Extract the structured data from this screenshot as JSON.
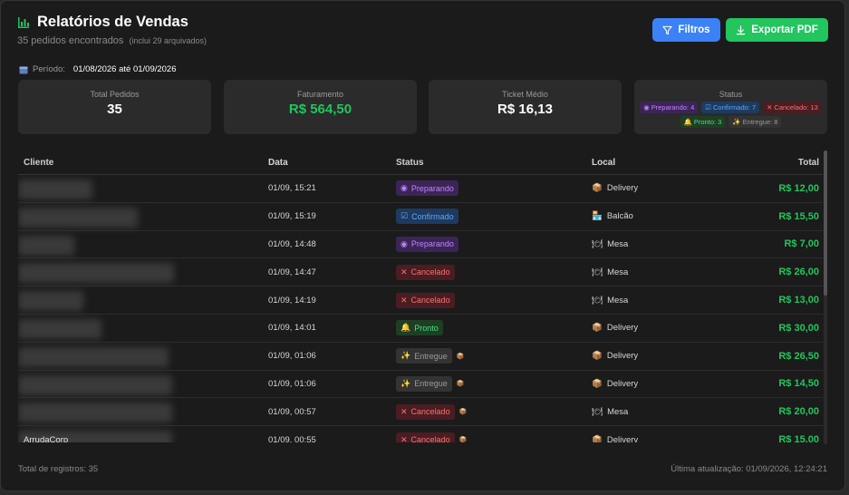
{
  "header": {
    "title": "Relatórios de Vendas",
    "subtitle": "35 pedidos encontrados",
    "subtitle_note": "(inclui 29 arquivados)"
  },
  "actions": {
    "filter_label": "Filtros",
    "export_label": "Exportar PDF"
  },
  "period": {
    "label": "Período:",
    "value": "01/08/2026 até 01/09/2026"
  },
  "cards": {
    "total_pedidos": {
      "label": "Total Pedidos",
      "value": "35"
    },
    "faturamento": {
      "label": "Faturamento",
      "value": "R$ 564,50"
    },
    "ticket": {
      "label": "Ticket Médio",
      "value": "R$ 16,13"
    },
    "status": {
      "label": "Status",
      "chips": [
        "Preparando: 4",
        "Confirmado: 7",
        "Cancelado: 13",
        "Pronto: 3",
        "Entregue: 8"
      ]
    }
  },
  "table": {
    "headers": {
      "cliente": "Cliente",
      "data": "Data",
      "status": "Status",
      "local": "Local",
      "total": "Total"
    },
    "rows": [
      {
        "cliente": "",
        "data": "01/09, 15:21",
        "status": "Preparando",
        "local": "Delivery",
        "total": "R$ 12,00"
      },
      {
        "cliente": "",
        "data": "01/09, 15:19",
        "status": "Confirmado",
        "local": "Balcão",
        "total": "R$ 15,50"
      },
      {
        "cliente": "",
        "data": "01/09, 14:48",
        "status": "Preparando",
        "local": "Mesa",
        "total": "R$ 7,00"
      },
      {
        "cliente": "",
        "data": "01/09, 14:47",
        "status": "Cancelado",
        "local": "Mesa",
        "total": "R$ 26,00"
      },
      {
        "cliente": "",
        "data": "01/09, 14:19",
        "status": "Cancelado",
        "local": "Mesa",
        "total": "R$ 13,00"
      },
      {
        "cliente": "",
        "data": "01/09, 14:01",
        "status": "Pronto",
        "local": "Delivery",
        "total": "R$ 30,00"
      },
      {
        "cliente": "",
        "data": "01/09, 01:06",
        "status": "Entregue",
        "local": "Delivery",
        "total": "R$ 26,50"
      },
      {
        "cliente": "",
        "data": "01/09, 01:06",
        "status": "Entregue",
        "local": "Delivery",
        "total": "R$ 14,50"
      },
      {
        "cliente": "",
        "data": "01/09, 00:57",
        "status": "Cancelado",
        "local": "Mesa",
        "total": "R$ 20,00"
      },
      {
        "cliente": "ArrudaCorp",
        "data": "01/09, 00:55",
        "status": "Cancelado",
        "local": "Delivery",
        "total": "R$ 15,00"
      }
    ]
  },
  "footer": {
    "total_registros": "Total de registros: 35",
    "ultima_atualizacao": "Última atualização: 01/09/2026, 12:24:21"
  },
  "colors": {
    "accent_blue": "#3b82f6",
    "accent_green": "#22c55e",
    "background": "#1b1b1b"
  }
}
